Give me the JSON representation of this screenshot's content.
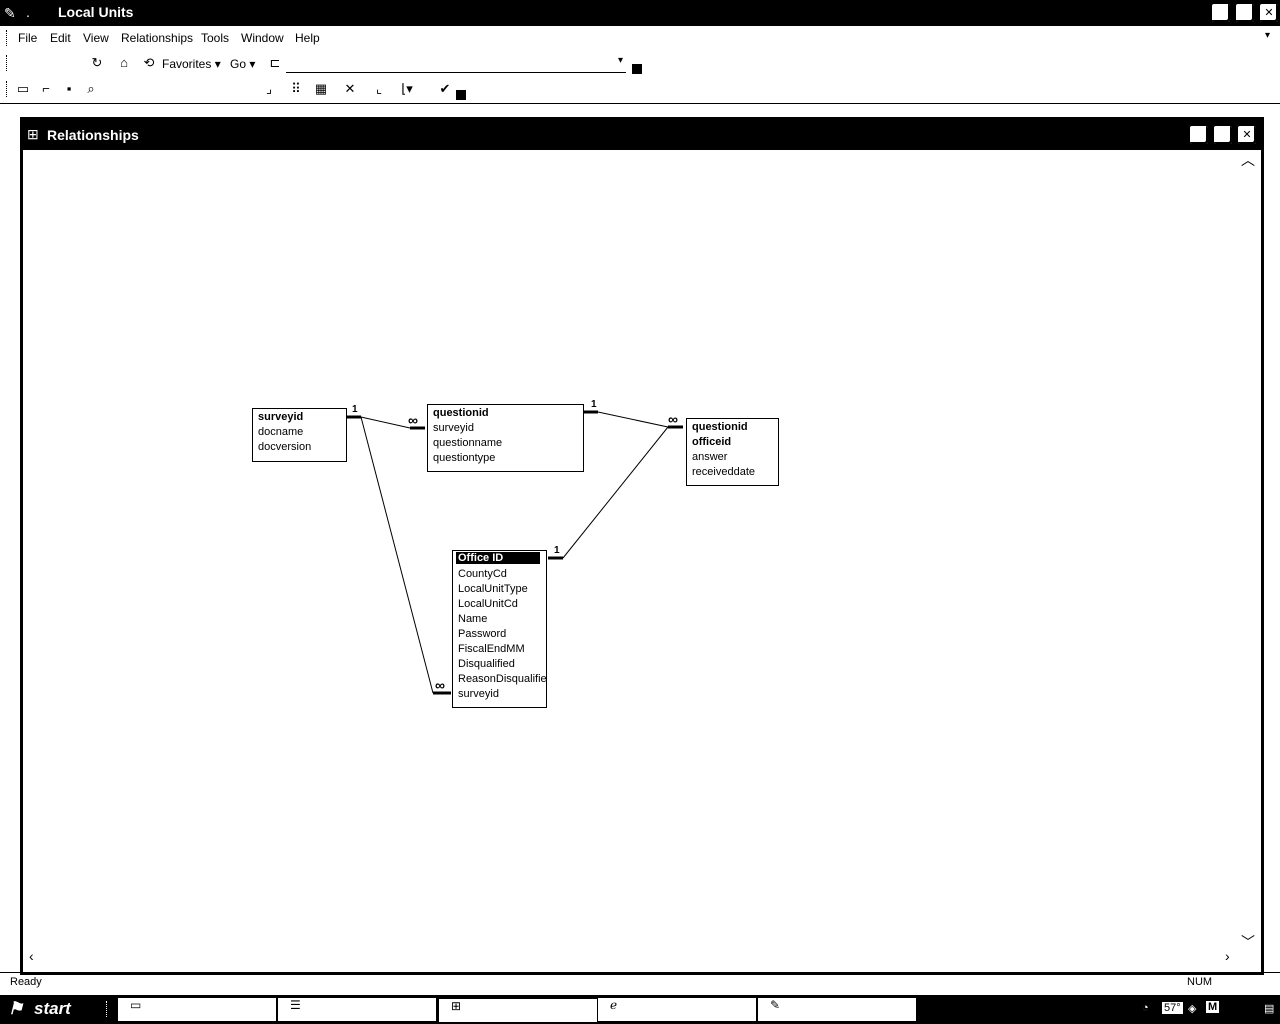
{
  "window": {
    "title": "Local Units",
    "buttons": {
      "minimize": "_",
      "maximize": "□",
      "close": "✕"
    }
  },
  "menu": [
    "File",
    "Edit",
    "View",
    "Relationships",
    "Tools",
    "Window",
    "Help"
  ],
  "web_toolbar": {
    "favorites_label": "Favorites",
    "go_label": "Go",
    "address_value": ""
  },
  "relationships_window": {
    "title": "Relationships"
  },
  "tables": {
    "surveys": {
      "fields": [
        "surveyid",
        "docname",
        "docversion"
      ]
    },
    "questions": {
      "fields": [
        "questionid",
        "surveyid",
        "questionname",
        "questiontype"
      ]
    },
    "answers": {
      "fields": [
        "questionid",
        "officeid",
        "answer",
        "receiveddate"
      ]
    },
    "offices": {
      "fields": [
        "Office ID",
        "CountyCd",
        "LocalUnitType",
        "LocalUnitCd",
        "Name",
        "Password",
        "FiscalEndMM",
        "Disqualified",
        "ReasonDisqualifie",
        "surveyid"
      ]
    }
  },
  "relationship_labels": {
    "one": "1",
    "many": "∞"
  },
  "status": {
    "left": "Ready",
    "right": "NUM"
  },
  "taskbar": {
    "start_label": "start",
    "tray_temp": "57°"
  },
  "icons": [
    "app-icon",
    "home-icon",
    "refresh-icon",
    "new-icon",
    "open-icon",
    "save-icon",
    "print-preview-icon",
    "delete-icon",
    "relationships-icon",
    "show-table-icon",
    "show-all-icon"
  ]
}
